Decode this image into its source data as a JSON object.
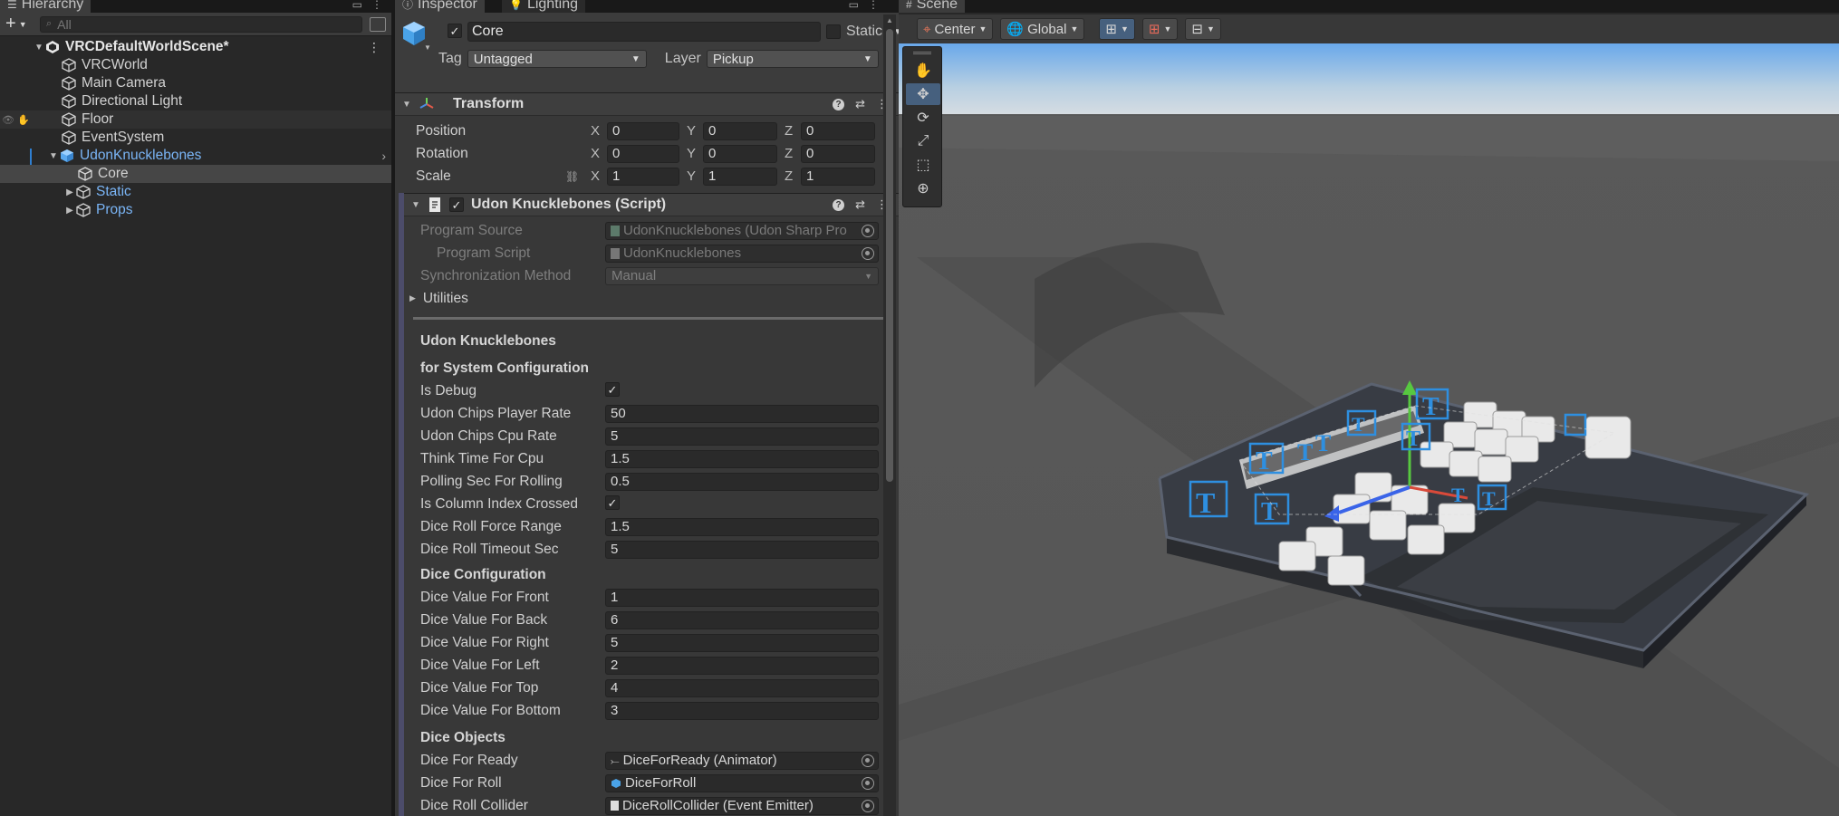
{
  "hierarchy": {
    "tab_label": "Hierarchy",
    "search_placeholder": "All",
    "items": [
      {
        "label": "VRCDefaultWorldScene*"
      },
      {
        "label": "VRCWorld"
      },
      {
        "label": "Main Camera"
      },
      {
        "label": "Directional Light"
      },
      {
        "label": "Floor"
      },
      {
        "label": "EventSystem"
      },
      {
        "label": "UdonKnucklebones"
      },
      {
        "label": "Core"
      },
      {
        "label": "Static"
      },
      {
        "label": "Props"
      }
    ]
  },
  "inspector": {
    "tab_label": "Inspector",
    "lighting_tab_label": "Lighting",
    "object_name": "Core",
    "static_label": "Static",
    "tag_label": "Tag",
    "tag_value": "Untagged",
    "layer_label": "Layer",
    "layer_value": "Pickup",
    "transform": {
      "title": "Transform",
      "position_label": "Position",
      "rotation_label": "Rotation",
      "scale_label": "Scale",
      "axis_x": "X",
      "axis_y": "Y",
      "axis_z": "Z",
      "position": [
        "0",
        "0",
        "0"
      ],
      "rotation": [
        "0",
        "0",
        "0"
      ],
      "scale": [
        "1",
        "1",
        "1"
      ]
    },
    "script": {
      "title": "Udon Knucklebones (Script)",
      "program_source_label": "Program Source",
      "program_source_value": "UdonKnucklebones (Udon Sharp Pro",
      "program_script_label": "Program Script",
      "program_script_value": "UdonKnucklebones",
      "sync_method_label": "Synchronization Method",
      "sync_method_value": "Manual",
      "utilities_label": "Utilities",
      "heading": "Udon Knucklebones",
      "system_config_title": "for System Configuration",
      "system_config": [
        {
          "label": "Is Debug",
          "checkbox": true
        },
        {
          "label": "Udon Chips Player Rate",
          "value": "50"
        },
        {
          "label": "Udon Chips Cpu Rate",
          "value": "5"
        },
        {
          "label": "Think Time For Cpu",
          "value": "1.5"
        },
        {
          "label": "Polling Sec For Rolling",
          "value": "0.5"
        },
        {
          "label": "Is Column Index Crossed",
          "checkbox": true
        },
        {
          "label": "Dice Roll Force Range",
          "value": "1.5"
        },
        {
          "label": "Dice Roll Timeout Sec",
          "value": "5"
        }
      ],
      "dice_config_title": "Dice Configuration",
      "dice_config": [
        {
          "label": "Dice Value For Front",
          "value": "1"
        },
        {
          "label": "Dice Value For Back",
          "value": "6"
        },
        {
          "label": "Dice Value For Right",
          "value": "5"
        },
        {
          "label": "Dice Value For Left",
          "value": "2"
        },
        {
          "label": "Dice Value For Top",
          "value": "4"
        },
        {
          "label": "Dice Value For Bottom",
          "value": "3"
        }
      ],
      "dice_objects_title": "Dice Objects",
      "dice_objects": [
        {
          "label": "Dice For Ready",
          "value": "DiceForReady (Animator)",
          "icon": "animator-icon"
        },
        {
          "label": "Dice For Roll",
          "value": "DiceForRoll",
          "icon": "gameobject-icon"
        },
        {
          "label": "Dice Roll Collider",
          "value": "DiceRollCollider (Event Emitter)",
          "icon": "script-icon"
        }
      ]
    }
  },
  "scene": {
    "tab_label": "Scene",
    "pivot_label": "Center",
    "space_label": "Global"
  },
  "colors": {
    "accent_blue": "#7ab5f6",
    "selection_blue": "#46607e",
    "panel_bg": "#383838"
  }
}
